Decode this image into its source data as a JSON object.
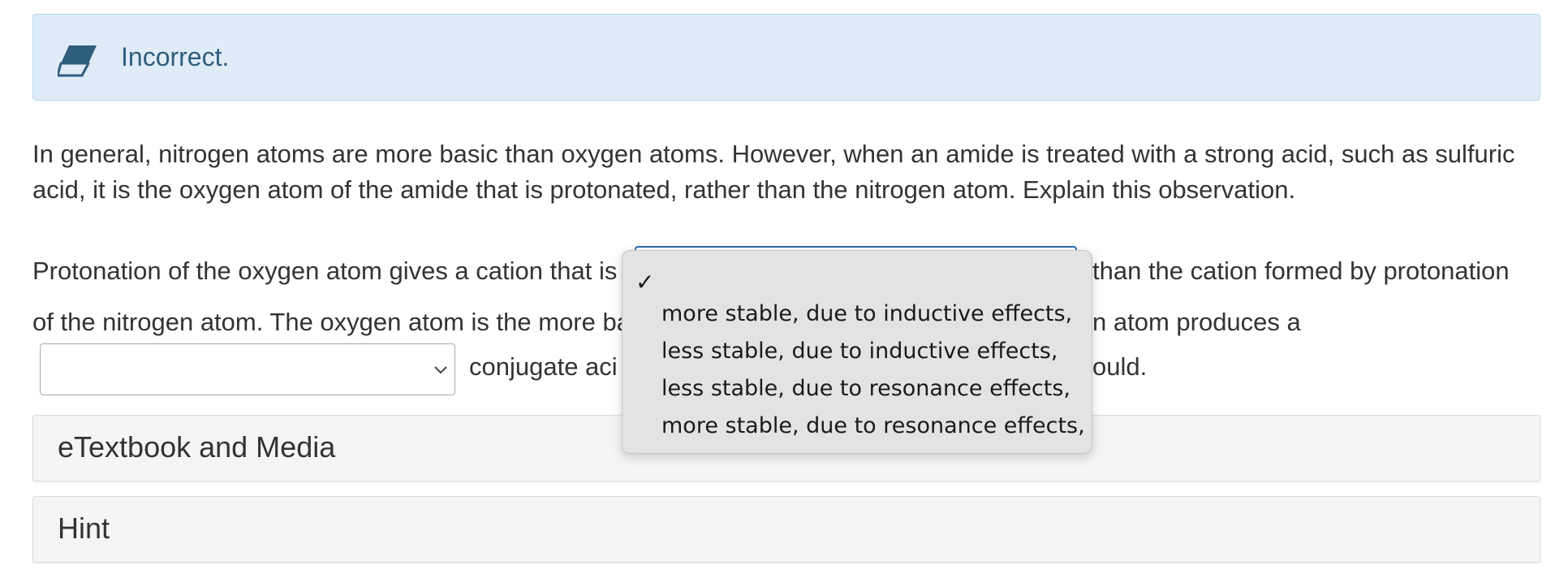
{
  "feedback": {
    "icon": "eraser-icon",
    "message": "Incorrect."
  },
  "question": {
    "text": "In general, nitrogen atoms are more basic than oxygen atoms. However, when an amide is treated with a strong acid, such as sulfuric acid, it is the oxygen atom of the amide that is protonated, rather than the nitrogen atom. Explain this observation."
  },
  "answer": {
    "line1_before": "Protonation of the oxygen atom gives a cation that is",
    "line1_after": "than the cation formed by protonation",
    "line2_start": "of the nitrogen atom. The oxygen atom is the more ba",
    "line2_end": "n atom produces a",
    "line3_mid": "conjugate aci",
    "line3_end": "ould.",
    "select1_value": "",
    "select2_value": ""
  },
  "dropdown": {
    "selected_mark": "✓",
    "options": [
      "more stable, due to inductive effects,",
      "less stable, due to inductive effects,",
      "less stable, due to resonance effects,",
      "more stable, due to resonance effects,"
    ]
  },
  "panels": {
    "etextbook_label": "eTextbook and Media",
    "hint_label": "Hint"
  },
  "colors": {
    "alert_bg": "#dfecf7",
    "alert_text": "#2f5d7c",
    "focus_border": "#2a6fb0"
  }
}
